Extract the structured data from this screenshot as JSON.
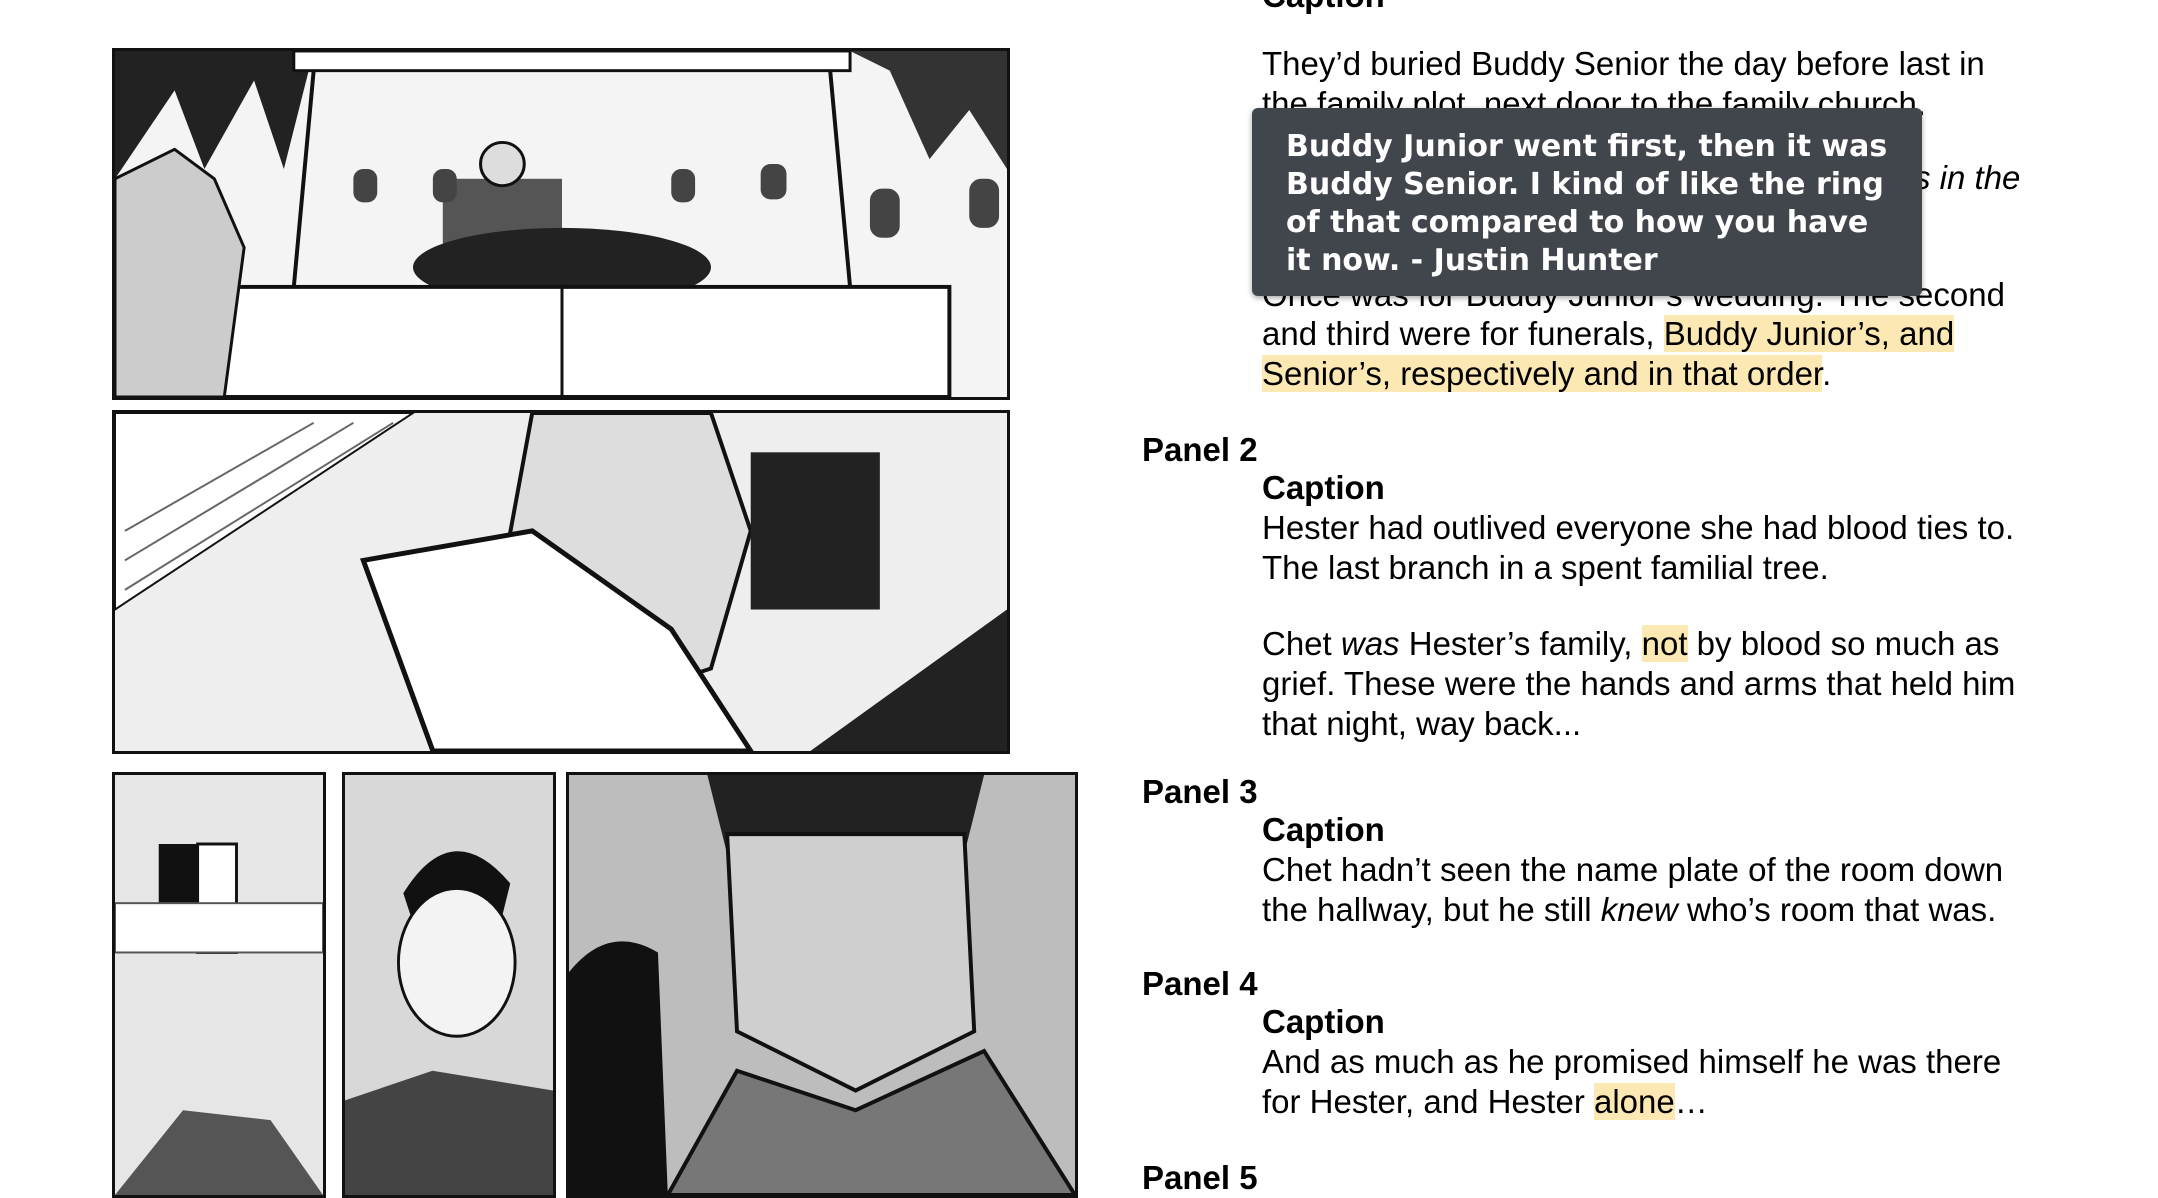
{
  "script": {
    "top_partial": "Caption",
    "intro_lines": [
      "They’d buried Buddy Senior the day before last in",
      "the family plot, next door to the family church."
    ],
    "hidden_fragment": "s in the",
    "hidden_line": "Once was for Buddy Junior’s wedding. The second",
    "line_and_third": "and third were for funerals, ",
    "hl_funerals_a": "Buddy Junior’s, and",
    "hl_funerals_b": "Senior’s, respectively and in that order",
    "period": ".",
    "panels": [
      {
        "heading": "Panel 2",
        "caption_label": "Caption",
        "para1_line1": "Hester had outlived everyone she had blood ties to.",
        "para1_line2": "The last branch in a spent familial tree.",
        "p2_a": "Chet ",
        "p2_was": "was",
        "p2_b": " Hester’s family, ",
        "p2_not": "not",
        "p2_c": " by blood so much as",
        "p2_line2": "grief. These were the hands and arms that held him",
        "p2_line3": "that night, way back..."
      },
      {
        "heading": "Panel 3",
        "caption_label": "Caption",
        "line1": "Chet hadn’t seen the name plate of the room down",
        "l2_a": "the hallway, but he still ",
        "l2_knew": "knew",
        "l2_b": " who’s room that was."
      },
      {
        "heading": "Panel 4",
        "caption_label": "Caption",
        "line1": "And as much as he promised himself he was there",
        "l2_a": "for Hester, and Hester ",
        "l2_alone": "alone",
        "l2_b": "…"
      },
      {
        "heading": "Panel 5"
      }
    ]
  },
  "comment_tooltip": {
    "text": "Buddy Junior went first, then it was Buddy Senior. I kind of like the ring of that compared to how you have it now. - Justin Hunter"
  },
  "colors": {
    "highlight": "#fce8b2",
    "tooltip_bg": "#41464c"
  }
}
